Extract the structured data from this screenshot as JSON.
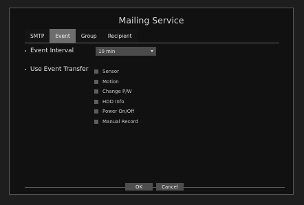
{
  "dialog": {
    "title": "Mailing Service"
  },
  "tabs": [
    {
      "label": "SMTP",
      "active": false
    },
    {
      "label": "Event",
      "active": true
    },
    {
      "label": "Group",
      "active": false
    },
    {
      "label": "Recipient",
      "active": false
    }
  ],
  "event_interval": {
    "label": "Event Interval",
    "value": "10 min"
  },
  "use_event_transfer": {
    "label": "Use Event Transfer",
    "options": [
      {
        "label": "Sensor",
        "checked": false
      },
      {
        "label": "Motion",
        "checked": false
      },
      {
        "label": "Change P/W",
        "checked": false
      },
      {
        "label": "HDD Info",
        "checked": false
      },
      {
        "label": "Power On/Off",
        "checked": false
      },
      {
        "label": "Manual Record",
        "checked": false
      }
    ]
  },
  "buttons": {
    "ok": "OK",
    "cancel": "Cancel"
  }
}
